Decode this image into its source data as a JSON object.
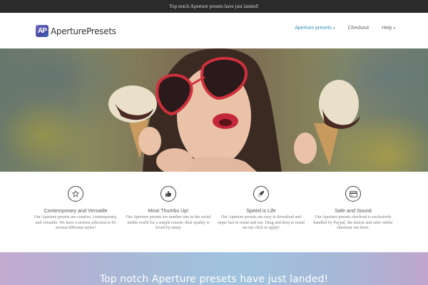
{
  "topbar": {
    "text": "Top notch Aperture presets have just landed!"
  },
  "header": {
    "logo_mark": "AP",
    "logo_text": "AperturePresets",
    "nav": [
      {
        "label": "Aperture presets",
        "has_dropdown": true,
        "active": true
      },
      {
        "label": "Checkout",
        "has_dropdown": false,
        "active": false
      },
      {
        "label": "Help",
        "has_dropdown": true,
        "active": false
      }
    ],
    "caret": "⌄"
  },
  "features": [
    {
      "icon": "star-icon",
      "title": "Contemporary and Versatile",
      "text": "Our Aperture presets are creative, contemporary, and versatile. We have a serious selection to fit several different styles!"
    },
    {
      "icon": "thumbs-up-icon",
      "title": "Most Thumbs Up!",
      "text": "Our Aperture presets are number one in the social media world for a simple reason: their quality is loved by many"
    },
    {
      "icon": "rocket-icon",
      "title": "Speed is Life",
      "text": "Our Aperture presets are easy to download and super fast to instal and use. Drag and drop to instal an one click to apply!"
    },
    {
      "icon": "credit-card-icon",
      "title": "Safe and Sound",
      "text": "Our Aperture presets checkout is exclusively handled by Paypal, the fastest and safer online checkout out there."
    }
  ],
  "banner": {
    "title": "Top notch Aperture presets have just landed!"
  },
  "colors": {
    "accent": "#3a8ec0",
    "topbar_bg": "#2b2b2b"
  }
}
